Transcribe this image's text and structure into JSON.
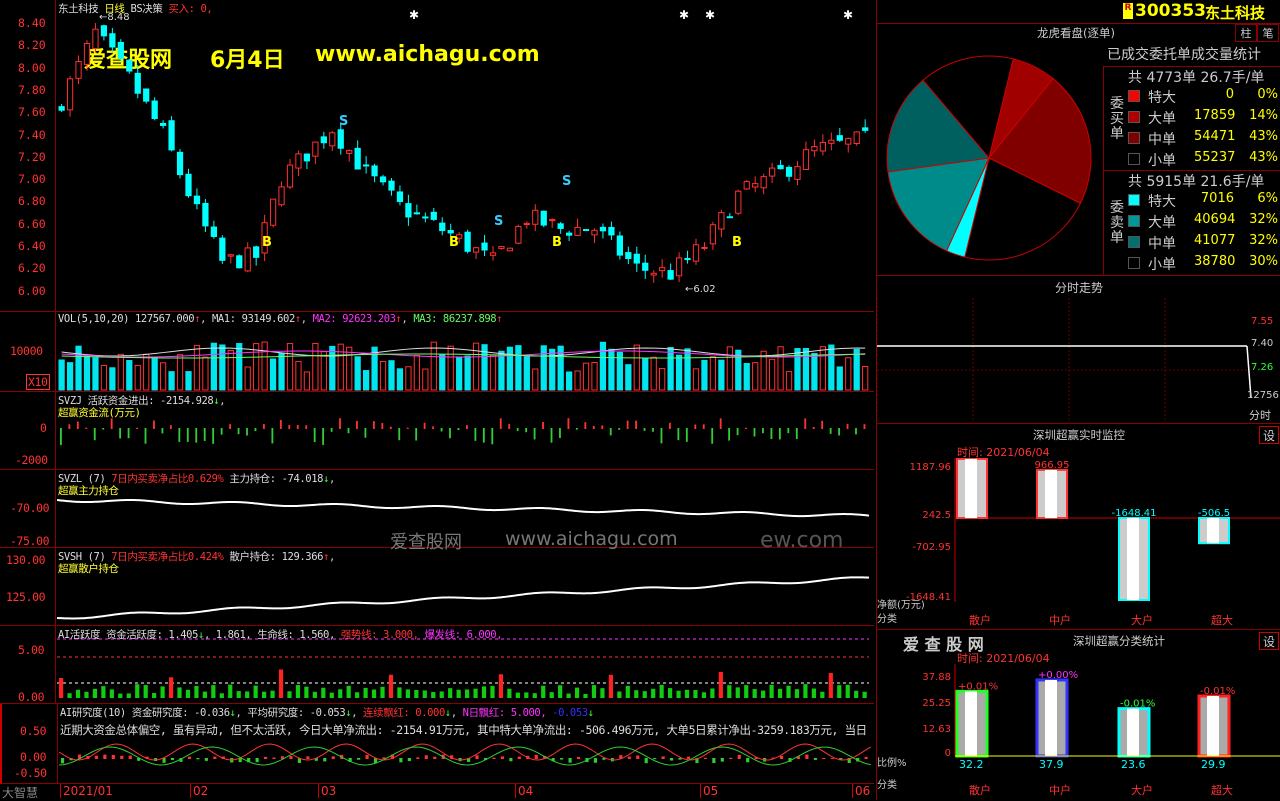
{
  "stock": {
    "code": "300353",
    "name": "东土科技",
    "r_badge": "R"
  },
  "main": {
    "title_name": "东土科技",
    "title_period": "日线",
    "title_strategy": "BS决策",
    "title_buy": "买入: 0,",
    "y_labels": [
      "8.40",
      "8.20",
      "8.00",
      "7.80",
      "7.60",
      "7.40",
      "7.20",
      "7.00",
      "6.80",
      "6.60",
      "6.40",
      "6.20",
      "6.00"
    ],
    "high_mark": "8.48",
    "low_mark": "6.02",
    "watermark_site": "爱查股网",
    "watermark_date": "6月4日",
    "watermark_url": "www.aichagu.com"
  },
  "vol": {
    "label": "VOL(5,10,20)",
    "v": "127567.000",
    "ma1": "MA1: 93149.602",
    "ma2": "MA2: 92623.203",
    "ma3": "MA3: 86237.898",
    "y_label": "10000",
    "unit": "X10"
  },
  "svzj": {
    "label": "SVZJ",
    "t1": "活跃资金进出: -2154.928",
    "sub": "超赢资金流(万元)",
    "y_labels": [
      "0",
      "-2000"
    ]
  },
  "svzl": {
    "label": "SVZL (7)",
    "t1": "7日内买卖净占比0.629%",
    "t2": "主力持仓: -74.018",
    "sub": "超赢主力持仓",
    "y_labels": [
      "-70.00",
      "-75.00"
    ]
  },
  "svsh": {
    "label": "SVSH (7)",
    "t1": "7日内买卖净占比0.424%",
    "t2": "散户持仓: 129.366",
    "sub": "超赢散户持仓",
    "y_labels": [
      "130.00",
      "125.00"
    ],
    "wm_site": "爱查股网",
    "wm_url": "www.aichagu.com",
    "wm_tail": "ew.com"
  },
  "ai": {
    "t1": "AI活跃度 资金活跃度: 1.405",
    "t2": "1.861, 生命线: 1.560,",
    "t3": "强势线: 3.000,",
    "t4": "爆发线: 6.000,",
    "y_labels": [
      "5.00",
      "0.00"
    ]
  },
  "aistudy": {
    "t1": "AI研究度(10) 资金研究度: -0.036",
    "t2": "平均研究度: -0.053",
    "t3": "连续飘红: 0.000",
    "t4": "N日飘红: 5.000,",
    "t5": "-0.053",
    "text": "近期大资金总体偏空, 虽有异动, 但不太活跃, 今日大单净流出: -2154.91万元, 其中特大单净流出: -506.496万元, 大单5日累计净出-3259.183万元, 当日",
    "y_labels": [
      "0.50",
      "0.00",
      "-0.50"
    ]
  },
  "xaxis": {
    "labels": [
      "2021/01",
      "02",
      "03",
      "04",
      "05",
      "06"
    ],
    "brand": "大智慧"
  },
  "dragon": {
    "header": "龙虎看盘(逐单)",
    "sub": "已成交委托单成交量统计",
    "buy_title": "委买单",
    "buy_total": "共 4773单 26.7手/单",
    "buy_rows": [
      {
        "name": "特大",
        "num": "0",
        "pct": "0%",
        "color": "#ff0000"
      },
      {
        "name": "大单",
        "num": "17859",
        "pct": "14%",
        "color": "#b00000"
      },
      {
        "name": "中单",
        "num": "54471",
        "pct": "43%",
        "color": "#800000"
      },
      {
        "name": "小单",
        "num": "55237",
        "pct": "43%",
        "color": "#000000"
      }
    ],
    "sell_title": "委卖单",
    "sell_total": "共 5915单 21.6手/单",
    "sell_rows": [
      {
        "name": "特大",
        "num": "7016",
        "pct": "6%",
        "color": "#00ffff"
      },
      {
        "name": "大单",
        "num": "40694",
        "pct": "32%",
        "color": "#009999"
      },
      {
        "name": "中单",
        "num": "41077",
        "pct": "32%",
        "color": "#007070"
      },
      {
        "name": "小单",
        "num": "38780",
        "pct": "30%",
        "color": "#000000"
      }
    ]
  },
  "toolbar": {
    "btn1": "柱",
    "btn2": "笔"
  },
  "intraday": {
    "header": "分时走势",
    "y_labels": [
      "7.55",
      "7.40",
      "7.26"
    ],
    "vol": "12756",
    "label": "分时"
  },
  "monitor": {
    "header": "深圳超赢实时监控",
    "time": "时间: 2021/06/04",
    "set": "设",
    "y_labels": [
      "1187.96",
      "242.5",
      "-702.95",
      "-1648.41"
    ],
    "values": [
      {
        "cat": "散户",
        "v": "1187.96"
      },
      {
        "cat": "中户",
        "v": "966.95"
      },
      {
        "cat": "大户",
        "v": "-1648.41"
      },
      {
        "cat": "超大",
        "v": "-506.5"
      }
    ],
    "left_label1": "净额(万元)",
    "left_label2": "分类"
  },
  "classify": {
    "header": "深圳超赢分类统计",
    "brand": "爱 查 股 网",
    "time": "时间: 2021/06/04",
    "set": "设",
    "y_labels": [
      "37.88",
      "25.25",
      "12.63",
      "0"
    ],
    "values": [
      {
        "cat": "散户",
        "v": "32.2",
        "chg": "+0.01%"
      },
      {
        "cat": "中户",
        "v": "37.9",
        "chg": "+0.00%"
      },
      {
        "cat": "大户",
        "v": "23.6",
        "chg": "-0.01%"
      },
      {
        "cat": "超大",
        "v": "29.9",
        "chg": "-0.01%"
      }
    ],
    "left_label1": "比例%",
    "left_label2": "分类"
  }
}
